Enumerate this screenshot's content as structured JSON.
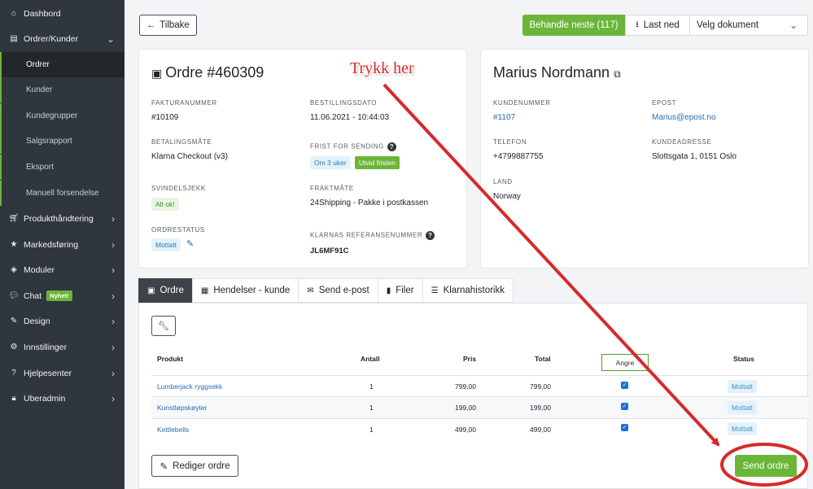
{
  "sidebar": {
    "items": [
      {
        "label": "Dashbord",
        "icon": "home-icon"
      },
      {
        "label": "Ordrer/Kunder",
        "icon": "inbox-icon"
      },
      {
        "label": "Produkthåndtering",
        "icon": "cart-icon"
      },
      {
        "label": "Markedsføring",
        "icon": "star-icon"
      },
      {
        "label": "Moduler",
        "icon": "box-icon"
      },
      {
        "label": "Chat",
        "icon": "chat-icon",
        "badge": "Nyhet!"
      },
      {
        "label": "Design",
        "icon": "pencil-icon"
      },
      {
        "label": "Innstillinger",
        "icon": "gears-icon"
      },
      {
        "label": "Hjelpesenter",
        "icon": "question-icon"
      },
      {
        "label": "Uberadmin",
        "icon": "lock-icon"
      }
    ],
    "subitems": [
      "Ordrer",
      "Kunder",
      "Kundegrupper",
      "Salgsrapport",
      "Eksport",
      "Manuell forsendelse"
    ]
  },
  "topbar": {
    "back_label": "Tilbake",
    "next_label": "Behandle neste (117)",
    "download_label": "Last ned",
    "select_doc": "Velg dokument"
  },
  "order": {
    "title": "Ordre #460309",
    "invoice_label": "FAKTURANUMMER",
    "invoice": "#10109",
    "order_date_label": "BESTILLINGSDATO",
    "order_date": "11.06.2021 - 10:44:03",
    "payment_label": "BETALINGSMÅTE",
    "payment": "Klarna Checkout (v3)",
    "deadline_label": "FRIST FOR SENDING",
    "deadline": "Om 3 uker",
    "extend": "Utvid fristen",
    "fraud_label": "SVINDELSJEKK",
    "fraud": "Alt ok!",
    "shipping_label": "FRAKTMÅTE",
    "shipping": "24Shipping - Pakke i postkassen",
    "status_label": "ORDRESTATUS",
    "status": "Mottatt",
    "klarna_ref_label": "KLARNAS REFERANSENUMMER",
    "klarna_ref": "JL6MF91C"
  },
  "customer": {
    "name": "Marius Nordmann",
    "number_label": "KUNDENUMMER",
    "number": "#1107",
    "email_label": "EPOST",
    "email": "Marius@epost.no",
    "phone_label": "TELEFON",
    "phone": "+4799887755",
    "address_label": "KUNDEADRESSE",
    "address": "Slottsgata 1, 0151 Oslo",
    "country_label": "LAND",
    "country": "Norway"
  },
  "tabs": [
    "Ordre",
    "Hendelser - kunde",
    "Send e-post",
    "Filer",
    "Klarnahistorikk"
  ],
  "table": {
    "headers": [
      "Produkt",
      "Antall",
      "Pris",
      "Total",
      "Angre",
      "Status"
    ],
    "rows": [
      {
        "product": "Lumberjack ryggsekk",
        "qty": "1",
        "price": "799,00",
        "total": "799,00",
        "checked": true,
        "status": "Mottatt"
      },
      {
        "product": "Kunstløpskøyter",
        "qty": "1",
        "price": "199,00",
        "total": "199,00",
        "checked": true,
        "status": "Mottatt"
      },
      {
        "product": "Kettlebells",
        "qty": "1",
        "price": "499,00",
        "total": "499,00",
        "checked": true,
        "status": "Mottatt"
      }
    ]
  },
  "actions": {
    "edit": "Rediger ordre",
    "send": "Send ordre"
  },
  "annotation": {
    "text": "Trykk her",
    "color": "#d62a2a"
  },
  "colors": {
    "accent": "#6bb63a",
    "sidebar": "#30363d",
    "link": "#2a6bb5"
  }
}
